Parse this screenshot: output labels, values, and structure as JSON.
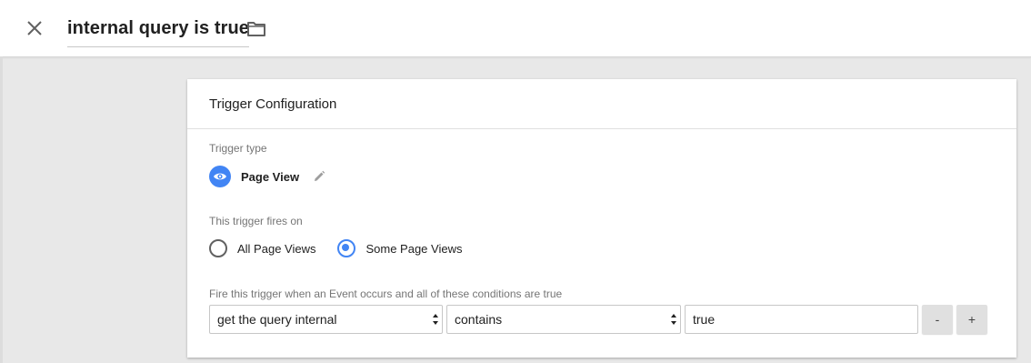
{
  "header": {
    "title": "internal query is true",
    "close_icon": "close-icon",
    "folder_icon": "folder-icon"
  },
  "card": {
    "title": "Trigger Configuration",
    "trigger_type": {
      "label": "Trigger type",
      "value": "Page View",
      "icon": "eye-icon",
      "icon_bg": "#4285f4",
      "edit_icon": "pencil-icon"
    },
    "fires_on": {
      "label": "This trigger fires on",
      "options": [
        {
          "label": "All Page Views",
          "selected": false
        },
        {
          "label": "Some Page Views",
          "selected": true
        }
      ]
    },
    "conditions": {
      "label": "Fire this trigger when an Event occurs and all of these conditions are true",
      "variable": "get the query internal",
      "operator": "contains",
      "value": "true",
      "remove_label": "-",
      "add_label": "+"
    }
  },
  "colors": {
    "accent": "#4285f4",
    "background": "#e8e8e8"
  }
}
